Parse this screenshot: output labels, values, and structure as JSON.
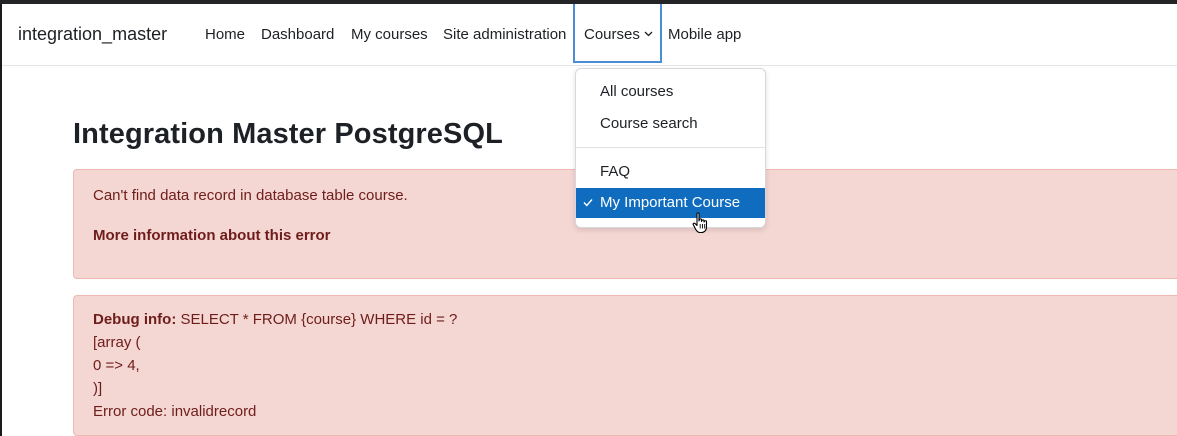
{
  "navbar": {
    "brand": "integration_master",
    "items": [
      {
        "label": "Home"
      },
      {
        "label": "Dashboard"
      },
      {
        "label": "My courses"
      },
      {
        "label": "Site administration"
      },
      {
        "label": "Courses"
      },
      {
        "label": "Mobile app"
      }
    ]
  },
  "page": {
    "title": "Integration Master PostgreSQL"
  },
  "error": {
    "message": "Can't find data record in database table course.",
    "more_info": "More information about this error"
  },
  "debug": {
    "label": "Debug info:",
    "query": " SELECT * FROM {course} WHERE id = ?",
    "lines": [
      "[array (",
      "0 => 4,",
      ")]",
      "Error code: invalidrecord"
    ]
  },
  "dropdown": {
    "items": [
      {
        "label": "All courses"
      },
      {
        "label": "Course search"
      },
      {
        "label": "FAQ"
      },
      {
        "label": "My Important Course",
        "active": true
      }
    ]
  },
  "colors": {
    "accent": "#0f6cbf",
    "alert_bg": "#f4d6d2",
    "alert_text": "#6e1d1a",
    "focus_border": "#4a8dd8"
  }
}
